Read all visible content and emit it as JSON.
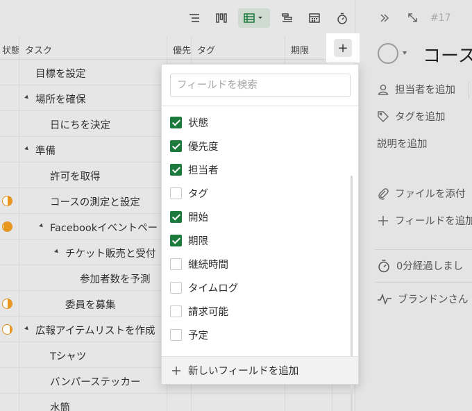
{
  "toolbar": {
    "icons": [
      "list-view-icon",
      "board-view-icon",
      "table-view-icon",
      "gantt-view-icon",
      "calendar-view-icon",
      "timer-icon"
    ]
  },
  "table": {
    "columns": {
      "status": "状態",
      "task": "タスク",
      "priority": "優先",
      "tags": "タグ",
      "due": "期限"
    },
    "add_column_label": "+",
    "rows": [
      {
        "task": "目標を設定",
        "indent": 0,
        "caret": false,
        "status": null
      },
      {
        "task": "場所を確保",
        "indent": 0,
        "caret": true,
        "status": null
      },
      {
        "task": "日にちを決定",
        "indent": 1,
        "caret": false,
        "status": null
      },
      {
        "task": "準備",
        "indent": 0,
        "caret": true,
        "status": null
      },
      {
        "task": "許可を取得",
        "indent": 1,
        "caret": false,
        "status": null
      },
      {
        "task": "コースの測定と設定",
        "indent": 1,
        "caret": false,
        "status": 0.5
      },
      {
        "task": "Facebookイベントペー",
        "indent": 1,
        "caret": true,
        "status": 0.9
      },
      {
        "task": "チケット販売と受付",
        "indent": 2,
        "caret": true,
        "status": null
      },
      {
        "task": "参加者数を予測",
        "indent": 3,
        "caret": false,
        "status": null
      },
      {
        "task": "委員を募集",
        "indent": 2,
        "caret": false,
        "status": 0.5
      },
      {
        "task": "広報アイテムリストを作成",
        "indent": 0,
        "caret": true,
        "status": 0.25
      },
      {
        "task": "Tシャツ",
        "indent": 1,
        "caret": false,
        "status": null
      },
      {
        "task": "バンパーステッカー",
        "indent": 1,
        "caret": false,
        "status": null
      },
      {
        "task": "水筒",
        "indent": 1,
        "caret": false,
        "status": null
      }
    ]
  },
  "field_popover": {
    "search_placeholder": "フィールドを検索",
    "fields": [
      {
        "label": "状態",
        "checked": true
      },
      {
        "label": "優先度",
        "checked": true
      },
      {
        "label": "担当者",
        "checked": true
      },
      {
        "label": "タグ",
        "checked": false
      },
      {
        "label": "開始",
        "checked": true
      },
      {
        "label": "期限",
        "checked": true
      },
      {
        "label": "継続時間",
        "checked": false
      },
      {
        "label": "タイムログ",
        "checked": false
      },
      {
        "label": "請求可能",
        "checked": false
      },
      {
        "label": "予定",
        "checked": false
      }
    ],
    "add_field_label": "新しいフィールドを追加"
  },
  "detail_panel": {
    "task_id": "#17",
    "title": "コース",
    "add_assignee": "担当者を追加",
    "add_tag": "タグを追加",
    "add_description": "説明を追加",
    "attach_file": "ファイルを添付",
    "add_field": "フィールドを追加",
    "time_elapsed": "0分経過しまし",
    "activity": "ブランドンさん"
  },
  "colors": {
    "accent_green": "#1b7a3c",
    "status_orange": "#e7961e"
  }
}
